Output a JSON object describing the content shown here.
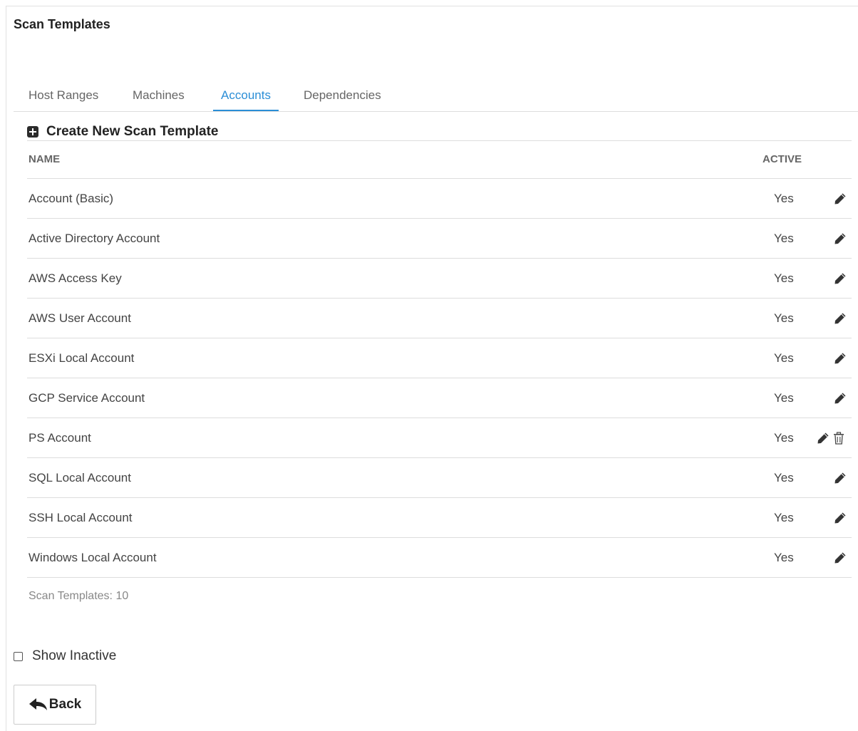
{
  "page": {
    "title": "Scan Templates"
  },
  "tabs": [
    {
      "label": "Host Ranges",
      "active": false
    },
    {
      "label": "Machines",
      "active": false
    },
    {
      "label": "Accounts",
      "active": true
    },
    {
      "label": "Dependencies",
      "active": false
    }
  ],
  "create": {
    "label": "Create New Scan Template",
    "icon": "plus-square-icon"
  },
  "table": {
    "columns": {
      "name": "NAME",
      "active": "ACTIVE"
    },
    "rows": [
      {
        "name": "Account (Basic)",
        "active": "Yes",
        "actions": [
          "edit"
        ]
      },
      {
        "name": "Active Directory Account",
        "active": "Yes",
        "actions": [
          "edit"
        ]
      },
      {
        "name": "AWS Access Key",
        "active": "Yes",
        "actions": [
          "edit"
        ]
      },
      {
        "name": "AWS User Account",
        "active": "Yes",
        "actions": [
          "edit"
        ]
      },
      {
        "name": "ESXi Local Account",
        "active": "Yes",
        "actions": [
          "edit"
        ]
      },
      {
        "name": "GCP Service Account",
        "active": "Yes",
        "actions": [
          "edit"
        ]
      },
      {
        "name": "PS Account",
        "active": "Yes",
        "actions": [
          "edit",
          "delete"
        ]
      },
      {
        "name": "SQL Local Account",
        "active": "Yes",
        "actions": [
          "edit"
        ]
      },
      {
        "name": "SSH Local Account",
        "active": "Yes",
        "actions": [
          "edit"
        ]
      },
      {
        "name": "Windows Local Account",
        "active": "Yes",
        "actions": [
          "edit"
        ]
      }
    ]
  },
  "footer": {
    "count_text": "Scan Templates: 10"
  },
  "show_inactive": {
    "label": "Show Inactive",
    "checked": false
  },
  "back_button": {
    "label": "Back",
    "icon": "reply-arrow-icon"
  },
  "colors": {
    "accent": "#2b8ed6",
    "text": "#444444",
    "muted": "#888888",
    "border": "#dddddd"
  }
}
